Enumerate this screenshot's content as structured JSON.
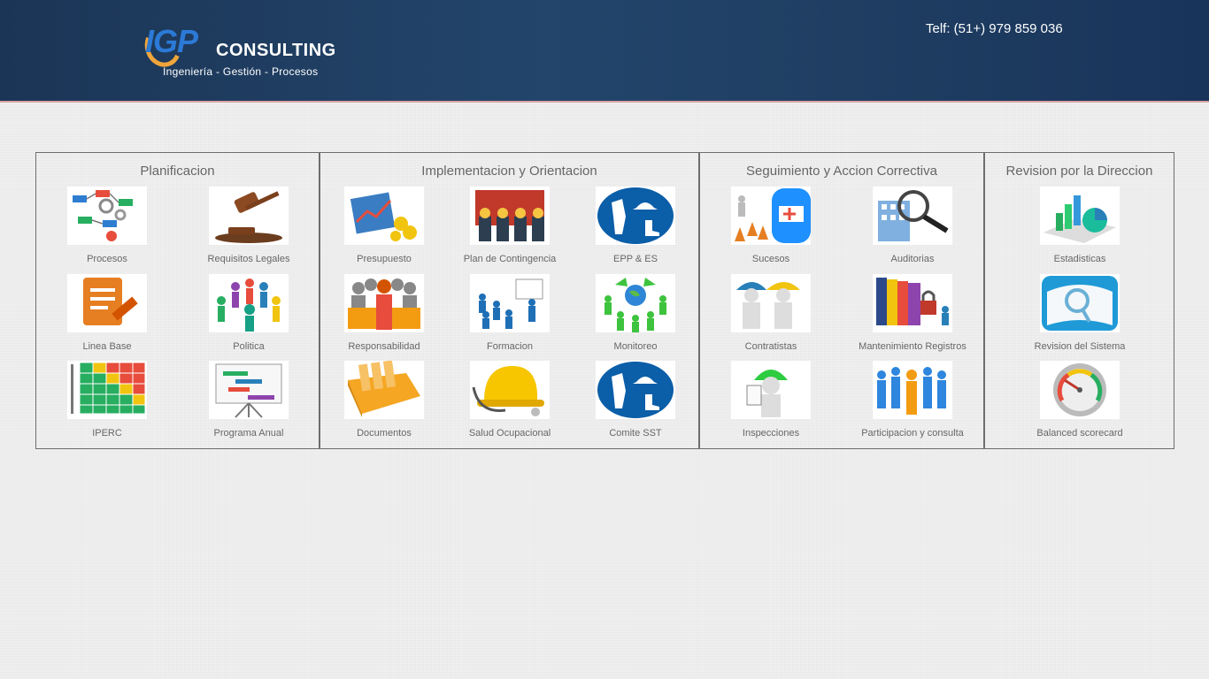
{
  "header": {
    "logo": {
      "mark": "IGP",
      "name": "CONSULTING",
      "tagline": "Ingeniería - Gestión - Procesos"
    },
    "phone": "Telf: (51+) 979 859 036"
  },
  "sections": [
    {
      "title": "Planificacion",
      "items": [
        {
          "label": "Procesos",
          "icon": "process-flow-icon"
        },
        {
          "label": "Requisitos Legales",
          "icon": "gavel-icon"
        },
        {
          "label": "Linea Base",
          "icon": "document-pencil-icon"
        },
        {
          "label": "Politica",
          "icon": "people-group-icon"
        },
        {
          "label": "IPERC",
          "icon": "risk-matrix-icon"
        },
        {
          "label": "Programa Anual",
          "icon": "gantt-board-icon"
        }
      ]
    },
    {
      "title": "Implementacion y Orientacion",
      "items": [
        {
          "label": "Presupuesto",
          "icon": "budget-chart-icon"
        },
        {
          "label": "Plan de Contingencia",
          "icon": "firefighters-icon"
        },
        {
          "label": "EPP & ES",
          "icon": "safety-equipment-icon"
        },
        {
          "label": "Responsabilidad",
          "icon": "team-leader-icon"
        },
        {
          "label": "Formacion",
          "icon": "training-class-icon"
        },
        {
          "label": "Monitoreo",
          "icon": "recycle-globe-icon"
        },
        {
          "label": "Documentos",
          "icon": "file-drawer-icon"
        },
        {
          "label": "Salud Ocupacional",
          "icon": "helmet-stethoscope-icon"
        },
        {
          "label": "Comite SST",
          "icon": "safety-equipment-icon"
        }
      ]
    },
    {
      "title": "Seguimiento y Accion Correctiva",
      "items": [
        {
          "label": "Sucesos",
          "icon": "ambulance-icon"
        },
        {
          "label": "Auditorias",
          "icon": "magnifier-building-icon"
        },
        {
          "label": "Contratistas",
          "icon": "workers-icon"
        },
        {
          "label": "Mantenimiento Registros",
          "icon": "binders-lock-icon"
        },
        {
          "label": "Inspecciones",
          "icon": "inspector-clipboard-icon"
        },
        {
          "label": "Participacion y consulta",
          "icon": "crowd-icon"
        }
      ]
    },
    {
      "title": "Revision por la Direccion",
      "items": [
        {
          "label": "Estadisticas",
          "icon": "statistics-chart-icon"
        },
        {
          "label": "Revision del Sistema",
          "icon": "magnifier-review-icon"
        },
        {
          "label": "Balanced scorecard",
          "icon": "gauge-icon"
        }
      ]
    }
  ]
}
